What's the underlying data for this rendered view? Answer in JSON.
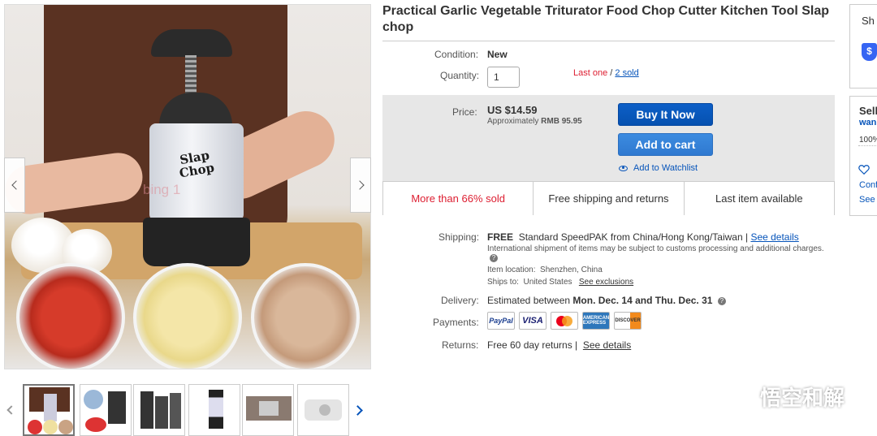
{
  "title": "Practical Garlic Vegetable Triturator Food Chop Cutter Kitchen Tool Slap chop",
  "image": {
    "product_logo_line1": "Slap",
    "product_logo_line2": "Chop",
    "watermark_text": "bing  1"
  },
  "condition": {
    "label": "Condition:",
    "value": "New"
  },
  "quantity": {
    "label": "Quantity:",
    "value": "1",
    "stock_note": "Last one",
    "separator": "/",
    "sold_link": "2 sold"
  },
  "price": {
    "label": "Price:",
    "amount": "US $14.59",
    "approx_label": "Approximately",
    "approx_value": "RMB 95.95"
  },
  "buttons": {
    "buy_now": "Buy It Now",
    "add_to_cart": "Add to cart",
    "watchlist": "Add to Watchlist"
  },
  "badges": [
    "More than 66% sold",
    "Free shipping and returns",
    "Last item available"
  ],
  "shipping": {
    "label": "Shipping:",
    "free": "FREE",
    "service": "Standard SpeedPAK from China/Hong Kong/Taiwan |",
    "details_link": "See details",
    "note": "International shipment of items may be subject to customs processing and additional charges.",
    "location_label": "Item location:",
    "location_value": "Shenzhen, China",
    "ships_to_label": "Ships to:",
    "ships_to_value": "United States",
    "exclusions_link": "See exclusions"
  },
  "delivery": {
    "label": "Delivery:",
    "prefix": "Estimated between",
    "dates": "Mon. Dec. 14 and Thu. Dec. 31"
  },
  "payments": {
    "label": "Payments:",
    "methods": [
      "PayPal",
      "VISA",
      "Mastercard",
      "AMERICAN EXPRESS",
      "DISCOVER"
    ]
  },
  "returns": {
    "label": "Returns:",
    "value": "Free 60 day returns |",
    "details_link": "See details"
  },
  "seller_panel": {
    "shop_title": "Sh",
    "shield_glyph": "$",
    "seller_title": "Sell",
    "seller_name": "wan",
    "feedback": "100%",
    "contact": "Conf",
    "see": "See"
  },
  "wechat_watermark": "悟空和解",
  "colors": {
    "link": "#0654ba",
    "buy_button": "#0654ba",
    "cart_button": "#3385dd",
    "alert_red": "#dd1e31"
  }
}
